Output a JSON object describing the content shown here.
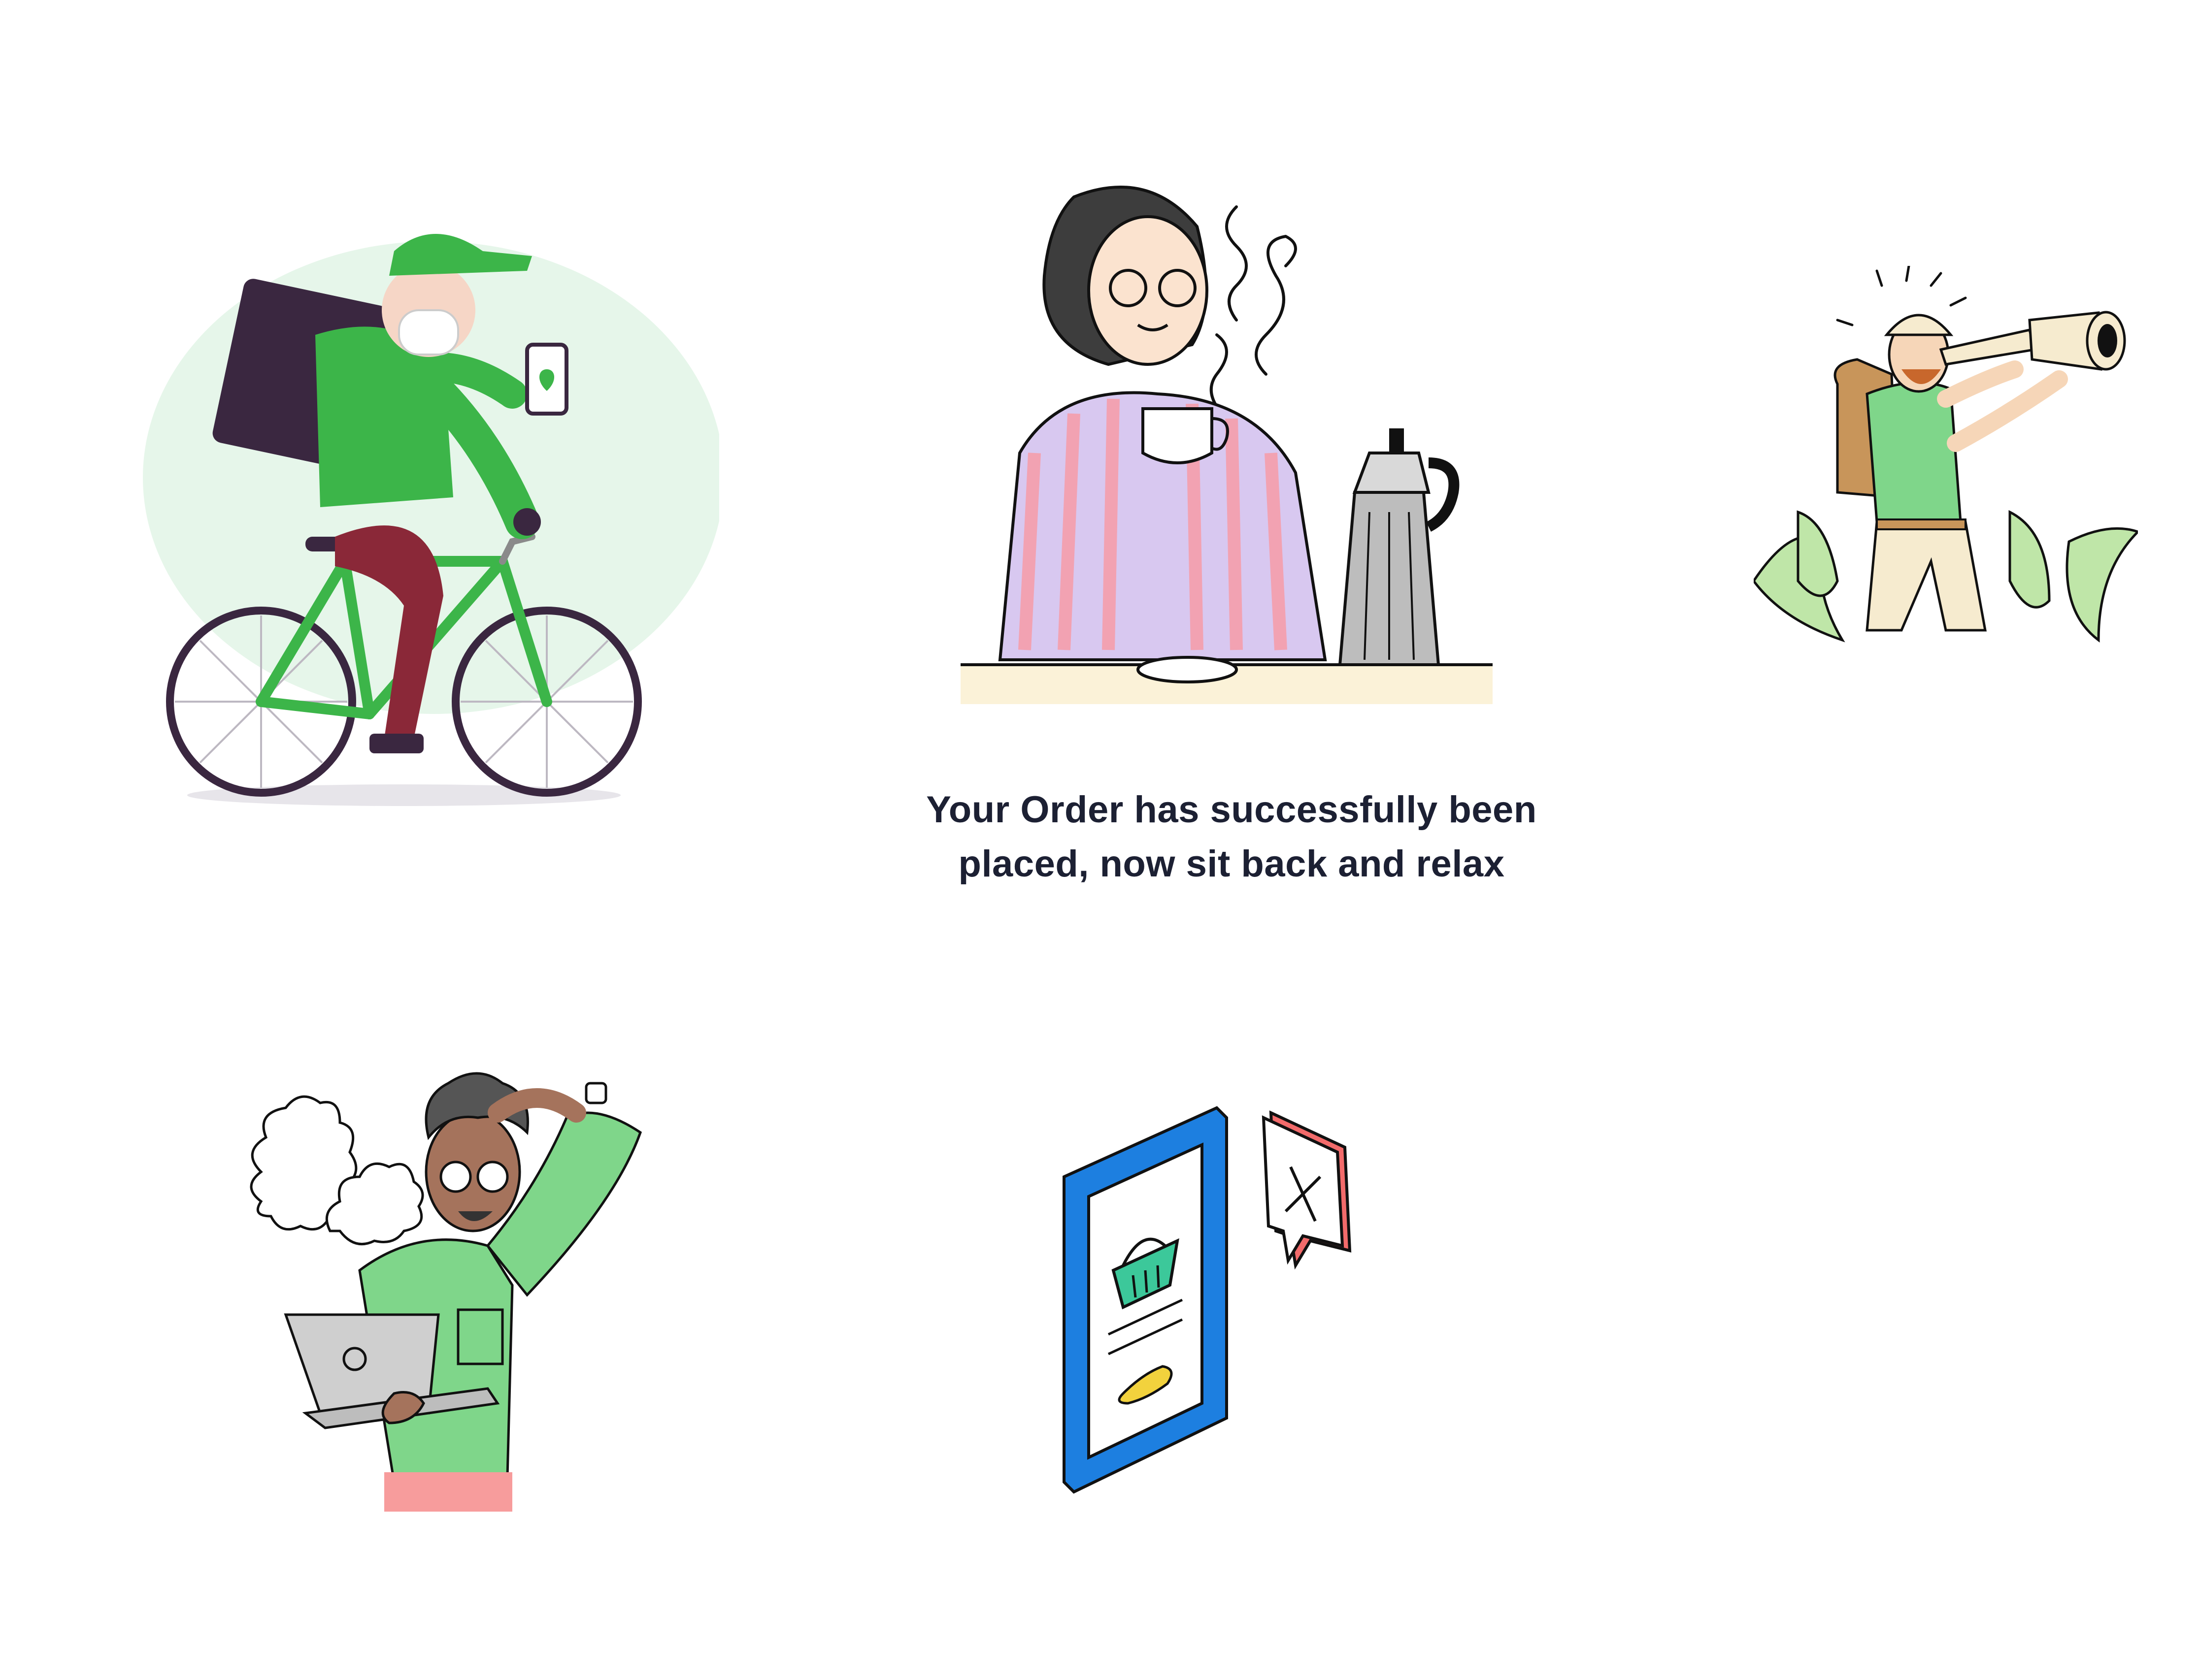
{
  "colors": {
    "background": "#ffffff",
    "text": "#1c2033",
    "brand_green": "#3cb549",
    "light_green": "#7fd68a",
    "blob_green": "#e6f6ea",
    "blue": "#1d7fe0",
    "coral": "#f36b6b",
    "yellow": "#f2d23d",
    "dark_purple": "#3a2740"
  },
  "illustrations": {
    "courier": {
      "icon": "delivery-courier-bicycle-illustration"
    },
    "relax": {
      "icon": "woman-drinking-coffee-illustration"
    },
    "explorer": {
      "icon": "explorer-with-telescope-illustration"
    },
    "confused": {
      "icon": "frustrated-man-smoking-laptop-illustration"
    },
    "failed_order": {
      "icon": "phone-basket-error-illustration"
    }
  },
  "success": {
    "line1": "Your Order has successfully been",
    "line2": "placed, now sit back and relax"
  }
}
